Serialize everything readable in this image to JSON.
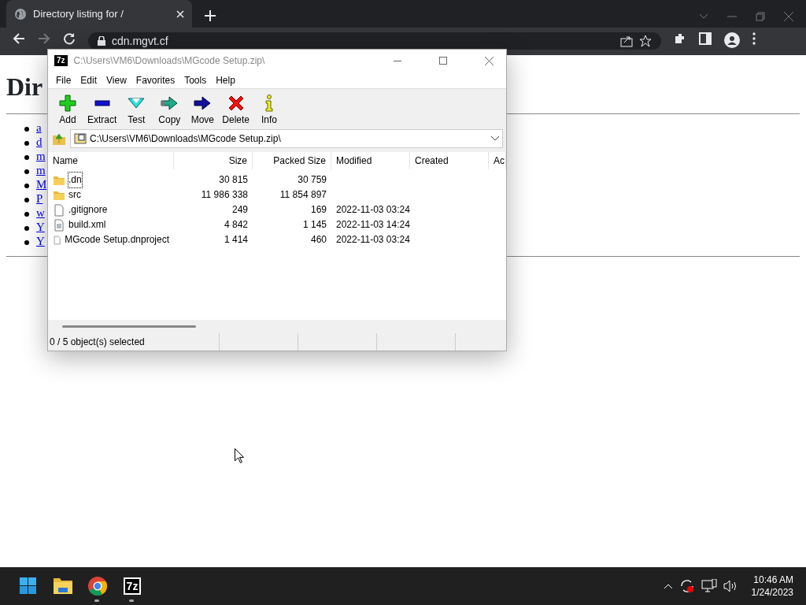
{
  "browser": {
    "tab": {
      "title": "Directory listing for /",
      "selected": true
    },
    "address": "cdn.mgvt.cf"
  },
  "page": {
    "heading": "Dir",
    "links": [
      "a",
      "d",
      "m",
      "m",
      "M",
      "P",
      "w",
      "Y",
      "Y"
    ]
  },
  "archive_window": {
    "logo": "7z",
    "title": "C:\\Users\\VM6\\Downloads\\MGcode Setup.zip\\",
    "menu": [
      "File",
      "Edit",
      "View",
      "Favorites",
      "Tools",
      "Help"
    ],
    "toolbar": [
      {
        "label": "Add",
        "kind": "add"
      },
      {
        "label": "Extract",
        "kind": "extract"
      },
      {
        "label": "Test",
        "kind": "test"
      },
      {
        "label": "Copy",
        "kind": "copy"
      },
      {
        "label": "Move",
        "kind": "move"
      },
      {
        "label": "Delete",
        "kind": "delete"
      },
      {
        "label": "Info",
        "kind": "info"
      }
    ],
    "path": "C:\\Users\\VM6\\Downloads\\MGcode Setup.zip\\",
    "columns": [
      "Name",
      "Size",
      "Packed Size",
      "Modified",
      "Created",
      "Ac"
    ],
    "rows": [
      {
        "name": ".dn",
        "kind": "folder",
        "size": "30 815",
        "packed": "30 759",
        "focused": true
      },
      {
        "name": "src",
        "kind": "folder",
        "size": "11 986 338",
        "packed": "11 854 897",
        "focused": false
      },
      {
        "name": ".gitignore",
        "kind": "file",
        "size": "249",
        "packed": "169",
        "modified": "2022-11-03 03:24",
        "focused": false
      },
      {
        "name": "build.xml",
        "kind": "xml",
        "size": "4 842",
        "packed": "1 145",
        "modified": "2022-11-03 14:24",
        "focused": false
      },
      {
        "name": "MGcode Setup.dnproject",
        "kind": "file",
        "size": "1 414",
        "packed": "460",
        "modified": "2022-11-03 03:24",
        "focused": false
      }
    ],
    "status": "0 / 5 object(s) selected"
  },
  "taskbar": {
    "apps": [
      {
        "kind": "start",
        "running": false
      },
      {
        "kind": "explorer",
        "running": false
      },
      {
        "kind": "chrome",
        "running": true
      },
      {
        "kind": "sevenzip",
        "label": "7z",
        "running": true
      }
    ],
    "time": "10:46 AM",
    "date": "1/24/2023"
  }
}
